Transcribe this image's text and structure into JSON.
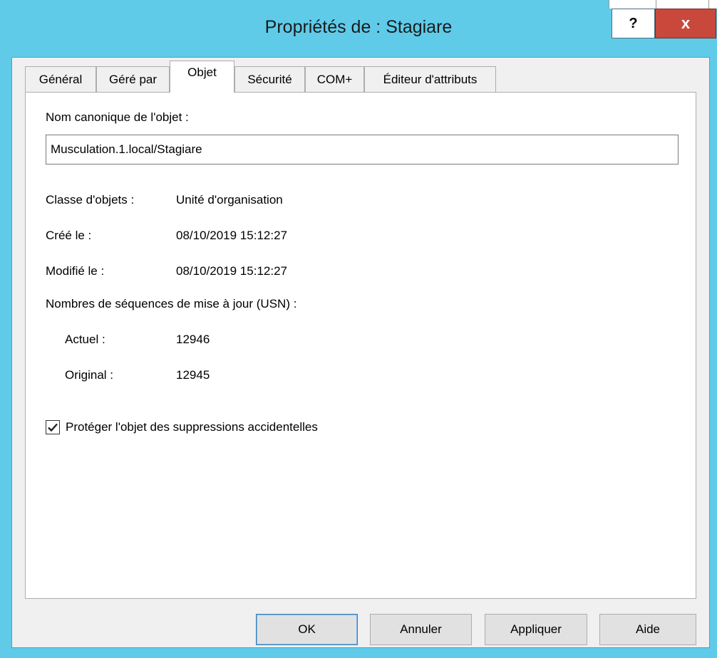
{
  "window": {
    "title": "Propriétés de : Stagiare",
    "help_label": "?",
    "close_label": "x"
  },
  "tabs": [
    {
      "label": "Général"
    },
    {
      "label": "Géré par"
    },
    {
      "label": "Objet",
      "active": true
    },
    {
      "label": "Sécurité"
    },
    {
      "label": "COM+"
    },
    {
      "label": "Éditeur d'attributs"
    }
  ],
  "object": {
    "canonical_label": "Nom canonique de l'objet :",
    "canonical_value": "Musculation.1.local/Stagiare",
    "class_label": "Classe d'objets :",
    "class_value": "Unité d'organisation",
    "created_label": "Créé le :",
    "created_value": "08/10/2019 15:12:27",
    "modified_label": "Modifié le :",
    "modified_value": "08/10/2019 15:12:27",
    "usn_label": "Nombres de séquences de mise à jour (USN) :",
    "current_label": "Actuel :",
    "current_value": "12946",
    "original_label": "Original :",
    "original_value": "12945",
    "protect_label": "Protéger l'objet des suppressions accidentelles",
    "protect_checked": true
  },
  "buttons": {
    "ok": "OK",
    "cancel": "Annuler",
    "apply": "Appliquer",
    "help": "Aide"
  },
  "colors": {
    "title_bar": "#5fcbe9",
    "close_button": "#c9483c"
  }
}
